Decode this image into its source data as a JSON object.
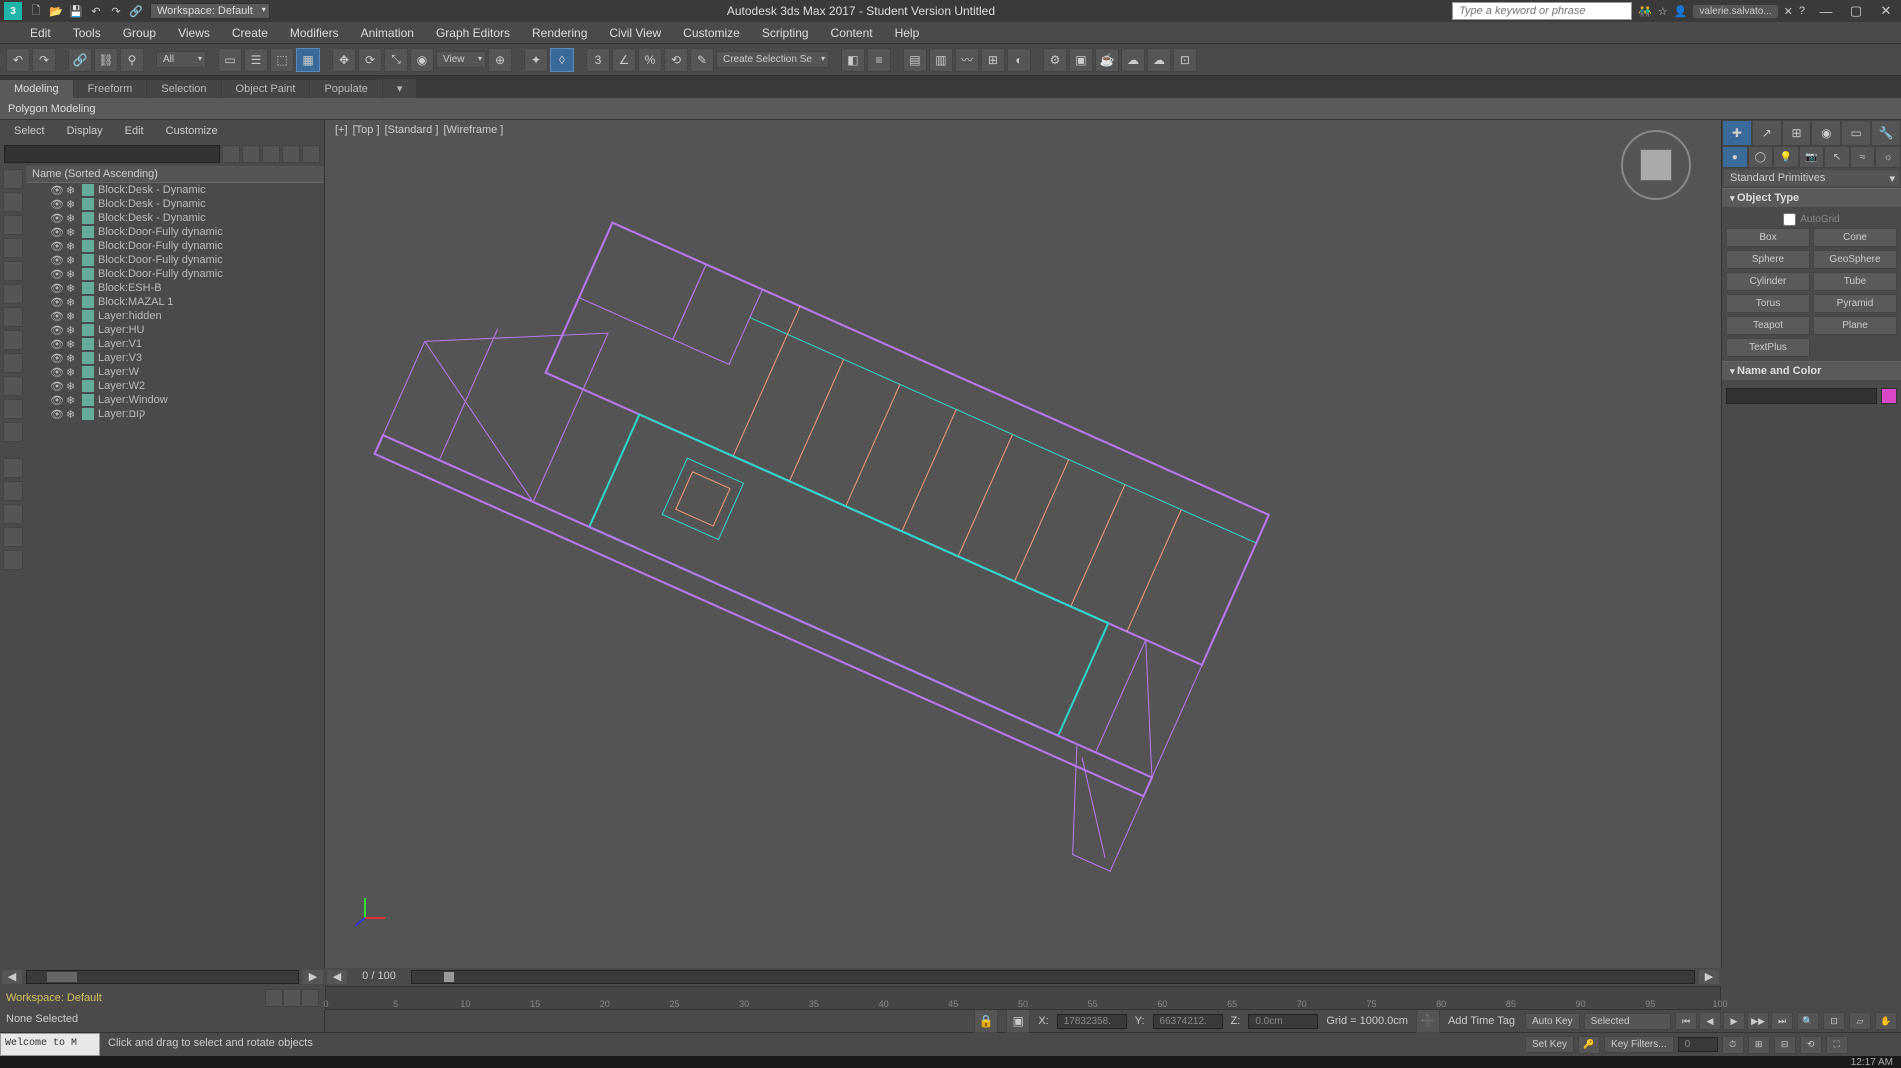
{
  "title": "Autodesk 3ds Max 2017 - Student Version     Untitled",
  "workspace_dropdown": "Workspace: Default",
  "search_placeholder": "Type a keyword or phrase",
  "user": "valerie.salvato...",
  "menus": [
    "Edit",
    "Tools",
    "Group",
    "Views",
    "Create",
    "Modifiers",
    "Animation",
    "Graph Editors",
    "Rendering",
    "Civil View",
    "Customize",
    "Scripting",
    "Content",
    "Help"
  ],
  "toolbar_filter": "All",
  "toolbar_view": "View",
  "toolbar_selset": "Create Selection Se",
  "ribbon_tabs": [
    "Modeling",
    "Freeform",
    "Selection",
    "Object Paint",
    "Populate"
  ],
  "sub_ribbon": "Polygon Modeling",
  "scene_menu": [
    "Select",
    "Display",
    "Edit",
    "Customize"
  ],
  "scene_header": "Name (Sorted Ascending)",
  "scene_items": [
    "Block:Desk - Dynamic",
    "Block:Desk - Dynamic",
    "Block:Desk - Dynamic",
    "Block:Door-Fully dynamic",
    "Block:Door-Fully dynamic",
    "Block:Door-Fully dynamic",
    "Block:Door-Fully dynamic",
    "Block:ESH-B",
    "Block:MAZAL 1",
    "Layer:hidden",
    "Layer:HU",
    "Layer:V1",
    "Layer:V3",
    "Layer:W",
    "Layer:W2",
    "Layer:Window",
    "Layer:קום"
  ],
  "viewport_label": {
    "a": "[+]",
    "b": "[Top ]",
    "c": "[Standard ]",
    "d": "[Wireframe ]"
  },
  "cmd_dropdown": "Standard Primitives",
  "rollout_object_type": "Object Type",
  "autogrid": "AutoGrid",
  "primitives": [
    [
      "Box",
      "Cone"
    ],
    [
      "Sphere",
      "GeoSphere"
    ],
    [
      "Cylinder",
      "Tube"
    ],
    [
      "Torus",
      "Pyramid"
    ],
    [
      "Teapot",
      "Plane"
    ]
  ],
  "textplus": "TextPlus",
  "rollout_name": "Name and Color",
  "timeline": {
    "frame_indicator": "0 / 100",
    "ticks": [
      0,
      5,
      10,
      15,
      20,
      25,
      30,
      35,
      40,
      45,
      50,
      55,
      60,
      65,
      70,
      75,
      80,
      85,
      90,
      95,
      100
    ]
  },
  "workspace_label": "Workspace: Default",
  "status": {
    "selection": "None Selected",
    "x_label": "X:",
    "x": "17832358.",
    "y_label": "Y:",
    "y": "66374212.",
    "z_label": "Z:",
    "z": "0.0cm",
    "grid_label": "Grid = 1000.0cm",
    "add_time_tag": "Add Time Tag",
    "autokey": "Auto Key",
    "setkey": "Set Key",
    "selected": "Selected",
    "keyfilters": "Key Filters..."
  },
  "maxscript": "Welcome to M",
  "prompt": "Click and drag to select and rotate objects",
  "clock": "12:17 AM",
  "frame_spinner": "0"
}
